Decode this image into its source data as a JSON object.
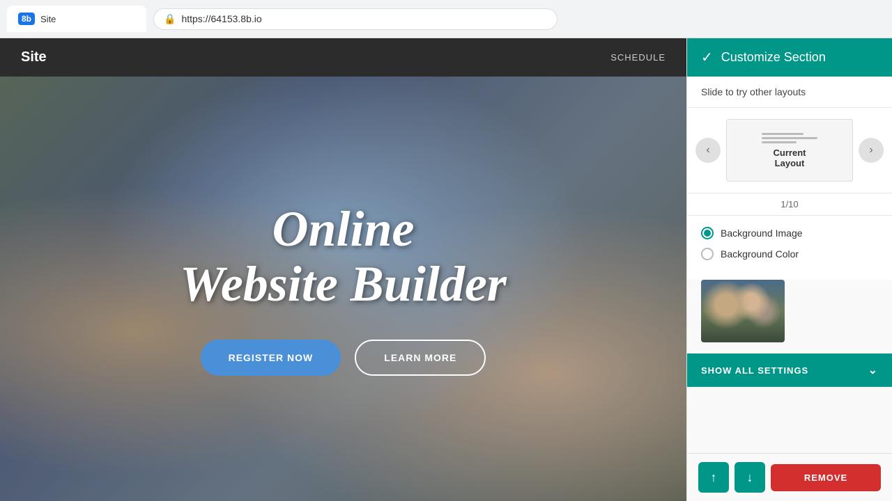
{
  "browser": {
    "tab_logo": "8b",
    "tab_title": "Site",
    "url": "https://64153.8b.io",
    "lock_icon": "🔒"
  },
  "site_nav": {
    "title": "Site",
    "links": [
      "SCHEDULE"
    ]
  },
  "hero": {
    "line1": "Online",
    "line2": "Website Builder",
    "btn_register": "REGISTER NOW",
    "btn_learn": "LEARN MORE"
  },
  "panel": {
    "header_title": "Customize Section",
    "check_icon": "✓",
    "subheader": "Slide to try other layouts",
    "layout_label": "Current\nLayout",
    "pagination": "1/10",
    "bg_image_label": "Background Image",
    "bg_color_label": "Background Color",
    "show_settings": "SHOW ALL SETTINGS",
    "remove_label": "REMOVE",
    "move_up": "↑",
    "move_down": "↓"
  }
}
